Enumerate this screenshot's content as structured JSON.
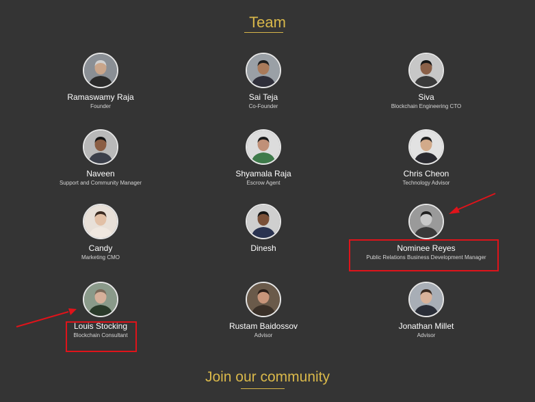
{
  "team": {
    "title": "Team",
    "members": [
      {
        "name": "Ramaswamy Raja",
        "role": "Founder",
        "colors": {
          "bg": "#8a8f95",
          "skin": "#c9a58a",
          "hair": "#d0d0d0",
          "shirt": "#2a2a2a"
        }
      },
      {
        "name": "Sai Teja",
        "role": "Co-Founder",
        "colors": {
          "bg": "#9aa0a6",
          "skin": "#a97a5a",
          "hair": "#1d1d1d",
          "shirt": "#2f2f3a"
        }
      },
      {
        "name": "Siva",
        "role": "Blockchain Engineering CTO",
        "colors": {
          "bg": "#c7c7c7",
          "skin": "#8a6048",
          "hair": "#151515",
          "shirt": "#3a3a3a"
        }
      },
      {
        "name": "Naveen",
        "role": "Support and Community Manager",
        "colors": {
          "bg": "#b9b9b9",
          "skin": "#8b5e44",
          "hair": "#141414",
          "shirt": "#3b3f4a"
        }
      },
      {
        "name": "Shyamala Raja",
        "role": "Escrow Agent",
        "colors": {
          "bg": "#dcdcdc",
          "skin": "#c09078",
          "hair": "#1a1a1a",
          "shirt": "#3e7a4a"
        }
      },
      {
        "name": "Chris Cheon",
        "role": "Technology Advisor",
        "colors": {
          "bg": "#e2e2e2",
          "skin": "#d2aa8a",
          "hair": "#1f1f1f",
          "shirt": "#2a2a30"
        }
      },
      {
        "name": "Candy",
        "role": "Marketing CMO",
        "colors": {
          "bg": "#e8e0d8",
          "skin": "#e2c0a6",
          "hair": "#3a2a20",
          "shirt": "#f0e8e0"
        }
      },
      {
        "name": "Dinesh",
        "role": "",
        "colors": {
          "bg": "#cfcfcf",
          "skin": "#7a5038",
          "hair": "#141414",
          "shirt": "#2a3350"
        }
      },
      {
        "name": "Nominee Reyes",
        "role": "Public Relations Business Development Manager",
        "colors": {
          "bg": "#9a9a9a",
          "skin": "#c8c8c8",
          "hair": "#202020",
          "shirt": "#3a3a3a"
        }
      },
      {
        "name": "Louis Stocking",
        "role": "Blockchain Consultant",
        "colors": {
          "bg": "#8a9a8a",
          "skin": "#d6b09a",
          "hair": "#7a6a5a",
          "shirt": "#2a3a2a"
        }
      },
      {
        "name": "Rustam Baidossov",
        "role": "Advisor",
        "colors": {
          "bg": "#6a5a4a",
          "skin": "#c8957a",
          "hair": "#2a1e18",
          "shirt": "#3a3028"
        }
      },
      {
        "name": "Jonathan Millet",
        "role": "Advisor",
        "colors": {
          "bg": "#a8aeb6",
          "skin": "#d8b29a",
          "hair": "#3a2a20",
          "shirt": "#2a2e38"
        }
      }
    ]
  },
  "community": {
    "title": "Join our community"
  },
  "colors": {
    "background": "#343434",
    "accent": "#d9b84a",
    "annotation": "#e0131a"
  }
}
